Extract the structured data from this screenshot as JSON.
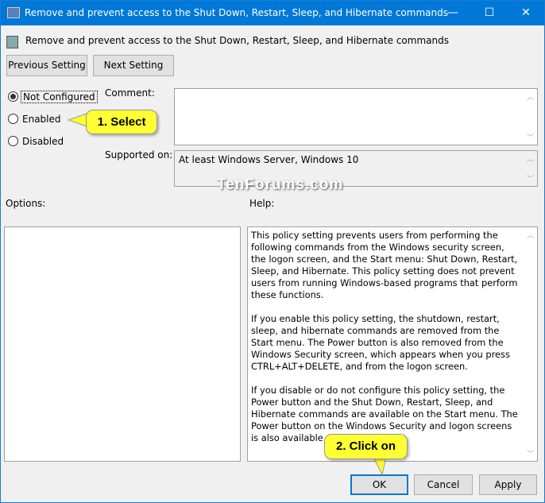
{
  "window": {
    "title": "Remove and prevent access to the Shut Down, Restart, Sleep, and Hibernate commands",
    "minimize": "—",
    "maximize": "☐",
    "close": "✕",
    "accent": "#0078d7"
  },
  "header": {
    "policy_name": "Remove and prevent access to the Shut Down, Restart, Sleep, and Hibernate commands"
  },
  "nav": {
    "previous": "Previous Setting",
    "next": "Next Setting"
  },
  "state": {
    "options": [
      {
        "label": "Not Configured",
        "selected": true
      },
      {
        "label": "Enabled",
        "selected": false
      },
      {
        "label": "Disabled",
        "selected": false
      }
    ]
  },
  "comment": {
    "label": "Comment:",
    "value": ""
  },
  "supported": {
    "label": "Supported on:",
    "value": "At least Windows Server, Windows 10"
  },
  "watermark": "TenForums.com",
  "options_label": "Options:",
  "help_label": "Help:",
  "help_text": "This policy setting prevents users from performing the following commands from the Windows security screen, the logon screen, and the Start menu: Shut Down, Restart, Sleep, and Hibernate. This policy setting does not prevent users from running Windows-based programs that perform these functions.\n\nIf you enable this policy setting, the shutdown, restart, sleep, and hibernate commands are removed from the Start menu. The Power button is also removed from the Windows Security screen, which appears when you press CTRL+ALT+DELETE, and from the logon screen.\n\nIf you disable or do not configure this policy setting, the Power button and the Shut Down, Restart, Sleep, and Hibernate commands are available on the Start menu. The Power button on the Windows Security and logon screens is also available.",
  "footer": {
    "ok": "OK",
    "cancel": "Cancel",
    "apply": "Apply"
  },
  "callouts": {
    "first": "1. Select",
    "second": "2. Click on"
  }
}
